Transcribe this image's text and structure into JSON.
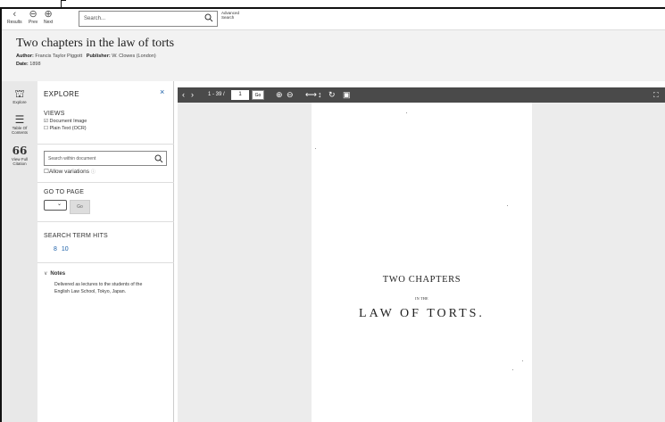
{
  "toolbar": {
    "results": "Results",
    "prev": "Prev",
    "next": "Next",
    "search_placeholder": "Search...",
    "advanced_search": "Advanced Search"
  },
  "header": {
    "title": "Two chapters in the law of torts",
    "author_label": "Author:",
    "author": "Francis Taylor Piggott",
    "publisher_label": "Publisher:",
    "publisher": "W. Clowes (London)",
    "date_label": "Date:",
    "date": "1898"
  },
  "rail": {
    "explore": "Explore",
    "toc": "Table Of Contents",
    "citation": "View Full Citation"
  },
  "panel": {
    "title": "EXPLORE",
    "close": "×",
    "views_label": "VIEWS",
    "view_doc": "Document Image",
    "view_text": "Plain Text (OCR)",
    "search_placeholder": "Search within document",
    "allow": "Allow variations",
    "goto_label": "GO TO PAGE",
    "go": "Go",
    "hits_label": "SEARCH TERM HITS",
    "hits": "8  10",
    "notes_label": "Notes",
    "notes_text": "Delivered as lectures to the students of the English Law School, Tokyo, Japan."
  },
  "viewer": {
    "page_range": "1 - 39 /",
    "page_value": "1",
    "go": "Go"
  },
  "page": {
    "line1": "TWO CHAPTERS",
    "line2": "IN THE",
    "line3": "LAW OF TORTS."
  }
}
